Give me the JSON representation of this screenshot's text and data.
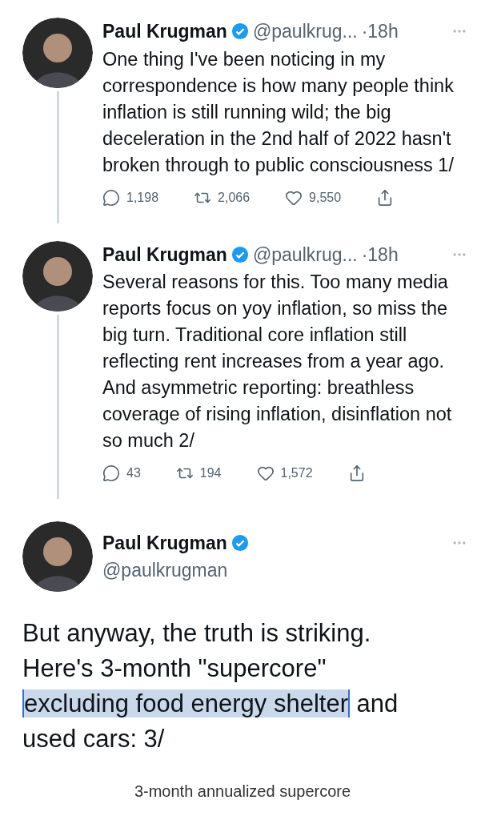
{
  "thread": [
    {
      "name": "Paul Krugman",
      "verified": true,
      "handle": "@paulkrug...",
      "time": "·18h",
      "text": "One thing I've been noticing in my correspondence is how many people think inflation is still running wild; the big deceleration in the 2nd half of 2022 hasn't broken through to public consciousness 1/",
      "replies": "1,198",
      "retweets": "2,066",
      "likes": "9,550"
    },
    {
      "name": "Paul Krugman",
      "verified": true,
      "handle": "@paulkrug...",
      "time": "·18h",
      "text": "Several reasons for this. Too many media reports focus on yoy inflation, so miss the big turn. Traditional core inflation still reflecting rent increases from a year ago. And asymmetric reporting: breathless coverage of rising inflation, disinflation not so much 2/",
      "replies": "43",
      "retweets": "194",
      "likes": "1,572"
    }
  ],
  "main_tweet": {
    "name": "Paul Krugman",
    "verified": true,
    "handle": "@paulkrugman",
    "text_parts": [
      {
        "text": "But anyway, the truth is striking. Here's 3-month \"supercore\" ",
        "selected": false
      },
      {
        "text": "excluding food energy shelter",
        "selected": true
      },
      {
        "text": " and used cars: 3/",
        "selected": false
      }
    ],
    "chart_title": "3-month annualized supercore"
  }
}
